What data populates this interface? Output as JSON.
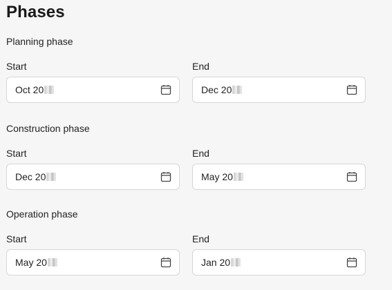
{
  "page": {
    "title": "Phases"
  },
  "phases": [
    {
      "title": "Planning phase",
      "start_label": "Start",
      "start_value": "Oct 20",
      "end_label": "End",
      "end_value": "Dec 20"
    },
    {
      "title": "Construction phase",
      "start_label": "Start",
      "start_value": "Dec 20",
      "end_label": "End",
      "end_value": "May 20"
    },
    {
      "title": "Operation phase",
      "start_label": "Start",
      "start_value": "May 20",
      "end_label": "End",
      "end_value": "Jan 20"
    }
  ],
  "icons": {
    "date_picker": "calendar-icon"
  },
  "colors": {
    "background": "#f6f6f6",
    "input_border": "#d6d6d6",
    "text": "#1f1f1f"
  }
}
